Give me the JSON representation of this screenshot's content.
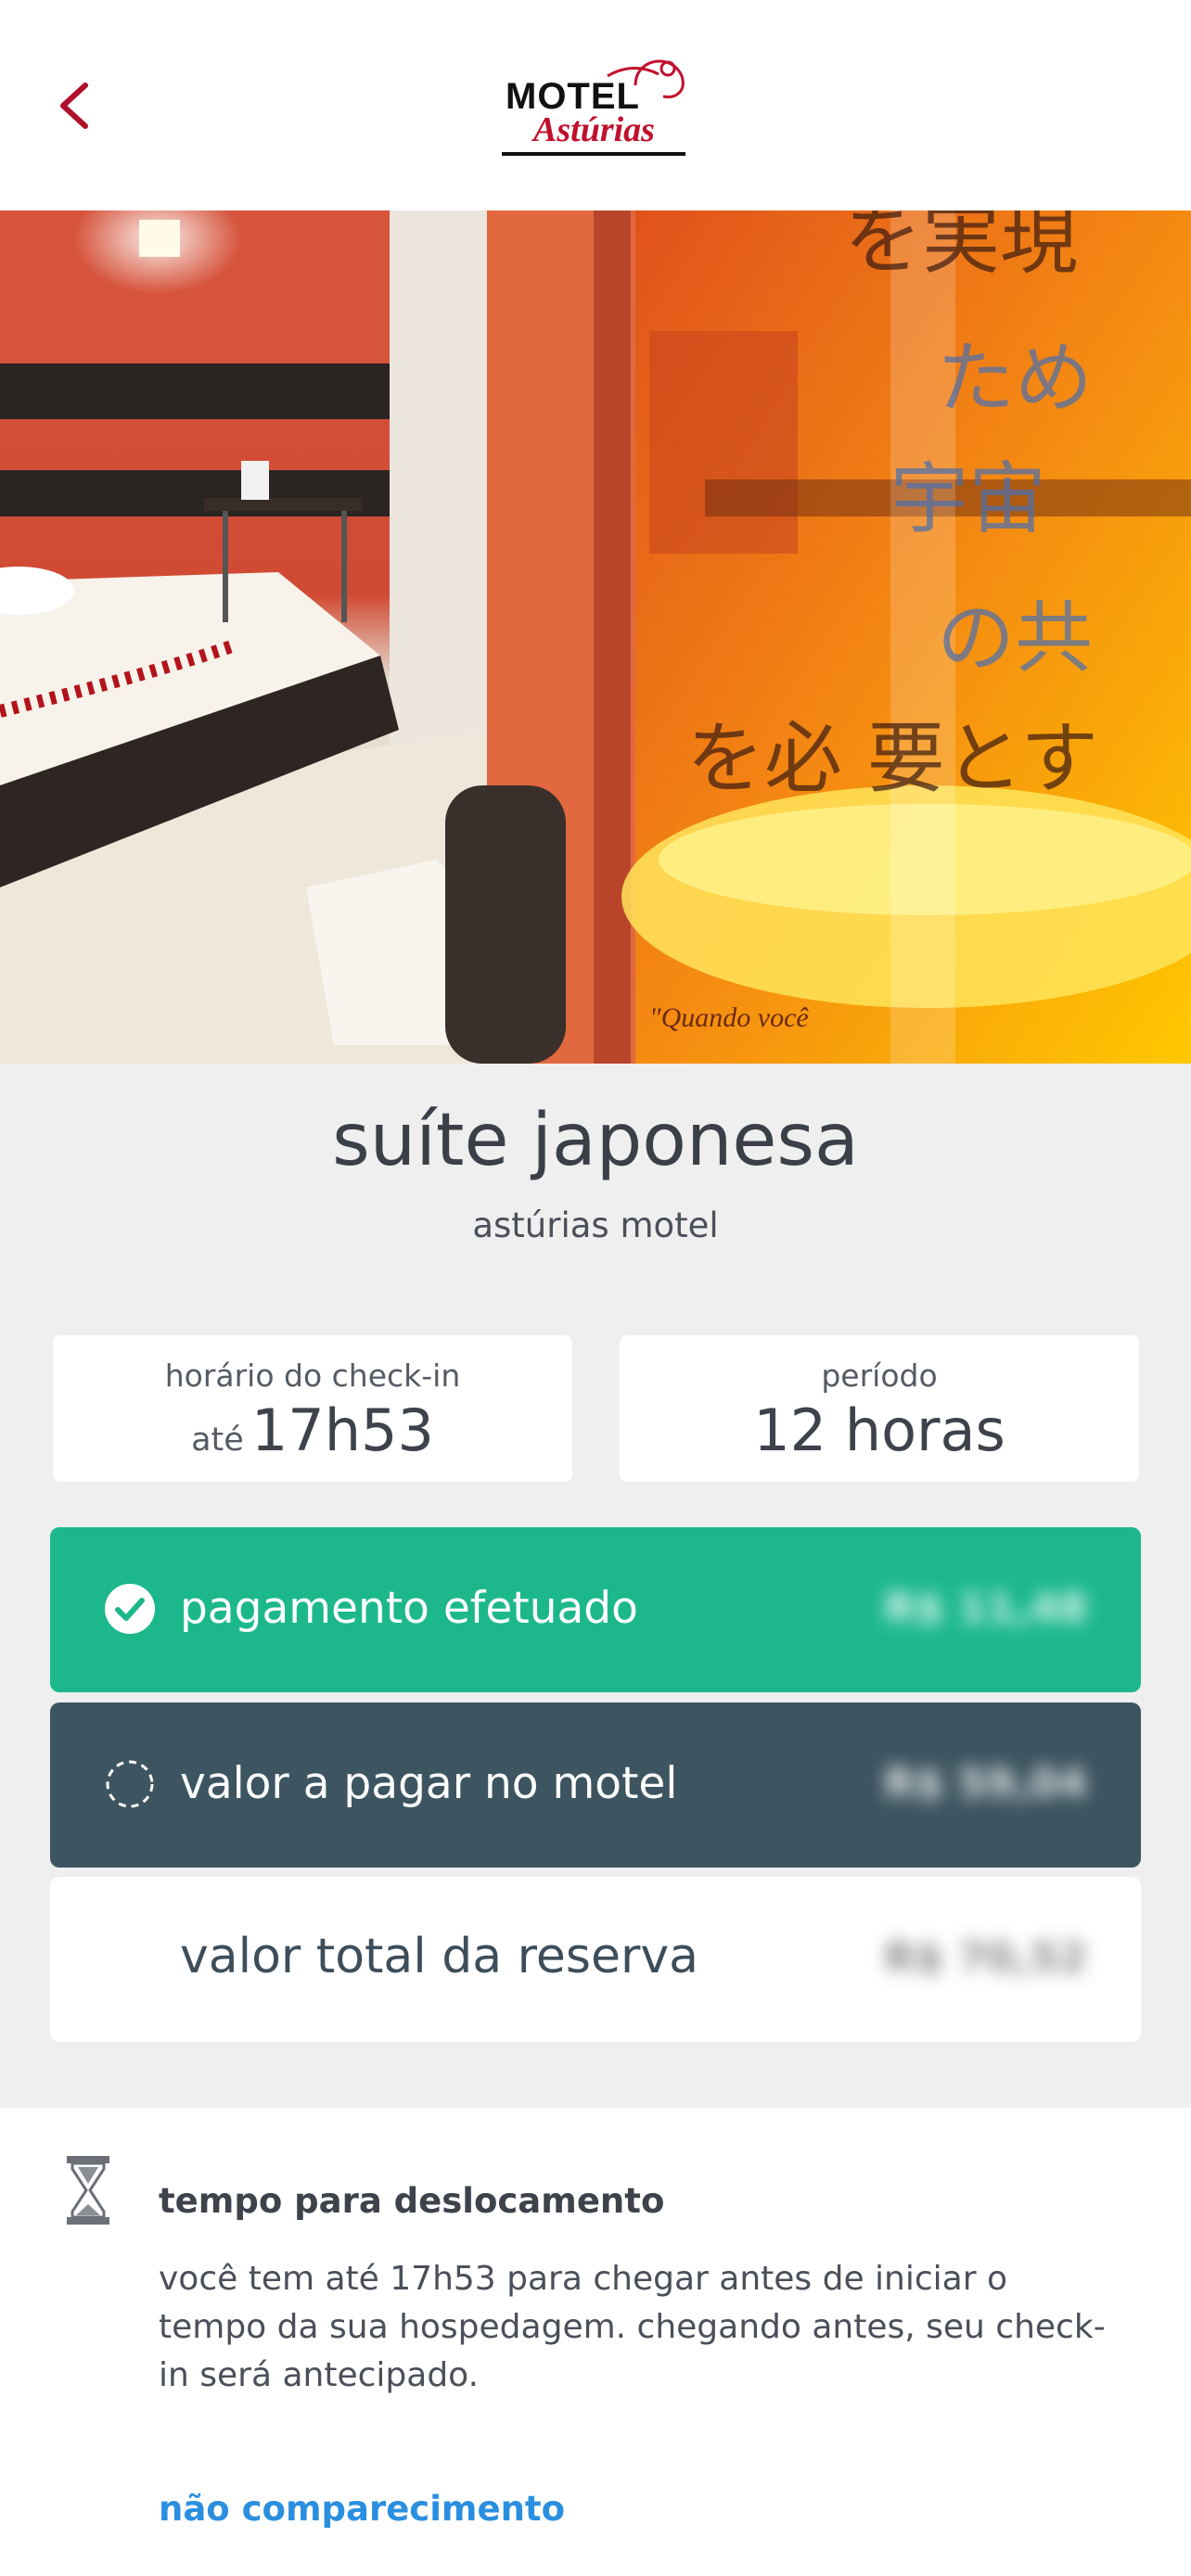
{
  "header": {
    "back_icon": "chevron-left-icon",
    "logo_top": "MOTEL",
    "logo_script": "Astúrias",
    "brand_color": "#b0102a"
  },
  "hero": {
    "image": "suite-photo"
  },
  "suite": {
    "name": "suíte japonesa",
    "motel": "astúrias motel"
  },
  "checkin": {
    "label": "horário do check-in",
    "prefix": "até",
    "time": "17h53"
  },
  "period": {
    "label": "período",
    "value": "12 horas"
  },
  "payments": {
    "paid": {
      "icon": "check-circle-icon",
      "label": "pagamento efetuado",
      "amount": "R$ 11,48",
      "color": "#1cb88c"
    },
    "due": {
      "icon": "dashed-circle-icon",
      "label": "valor a pagar no motel",
      "amount": "R$ 59,04",
      "color": "#3d5560"
    },
    "total": {
      "label": "valor total da reserva",
      "amount": "R$ 70,52"
    }
  },
  "travel": {
    "icon": "hourglass-icon",
    "title": "tempo para deslocamento",
    "text": "você tem até 17h53 para chegar antes de iniciar o tempo da sua hospedagem. chegando antes, seu check-in será antecipado."
  },
  "no_show": {
    "label": "não comparecimento",
    "color": "#2b8fe0"
  }
}
